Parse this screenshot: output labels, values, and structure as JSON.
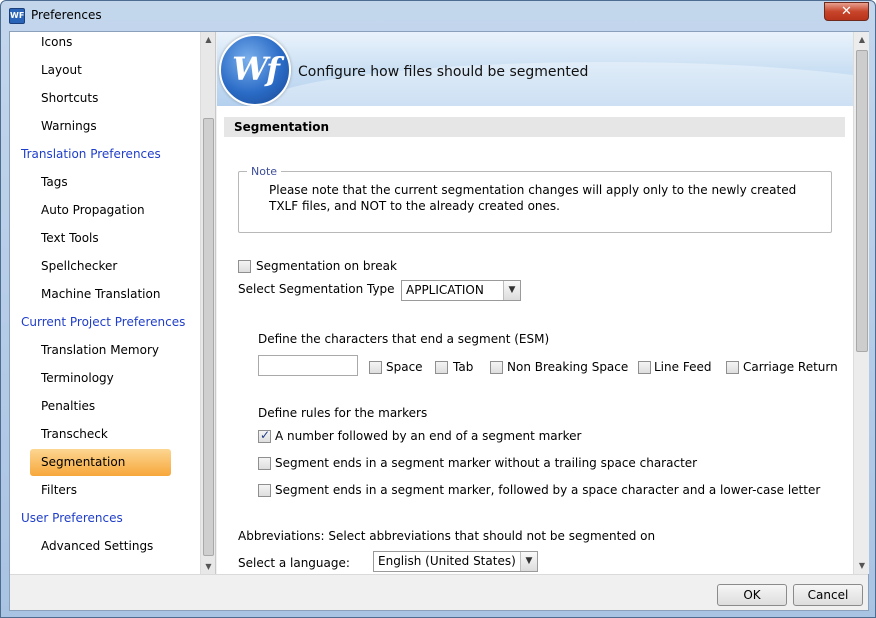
{
  "window": {
    "title": "Preferences",
    "icon_text": "WF"
  },
  "sidebar": {
    "items": [
      {
        "label": "Icons",
        "level": "child"
      },
      {
        "label": "Layout",
        "level": "child"
      },
      {
        "label": "Shortcuts",
        "level": "child"
      },
      {
        "label": "Warnings",
        "level": "child"
      },
      {
        "label": "Translation Preferences",
        "level": "header"
      },
      {
        "label": "Tags",
        "level": "child"
      },
      {
        "label": "Auto Propagation",
        "level": "child"
      },
      {
        "label": "Text Tools",
        "level": "child"
      },
      {
        "label": "Spellchecker",
        "level": "child"
      },
      {
        "label": "Machine Translation",
        "level": "child"
      },
      {
        "label": "Current Project Preferences",
        "level": "header"
      },
      {
        "label": "Translation Memory",
        "level": "child"
      },
      {
        "label": "Terminology",
        "level": "child"
      },
      {
        "label": "Penalties",
        "level": "child"
      },
      {
        "label": "Transcheck",
        "level": "child"
      },
      {
        "label": "Segmentation",
        "level": "child",
        "selected": true
      },
      {
        "label": "Filters",
        "level": "child"
      },
      {
        "label": "User Preferences",
        "level": "header"
      },
      {
        "label": "Advanced Settings",
        "level": "child"
      }
    ]
  },
  "banner": {
    "logo_text": "Wf",
    "title": "Configure how files should be segmented"
  },
  "section": {
    "title": "Segmentation"
  },
  "note": {
    "legend": "Note",
    "text": "Please note that the current segmentation changes will apply only to the newly created TXLF files, and NOT to the already created ones."
  },
  "segmentation_on_break": {
    "label": "Segmentation on break",
    "checked": false
  },
  "segmentation_type": {
    "label": "Select Segmentation Type",
    "value": "APPLICATION"
  },
  "esm": {
    "label": "Define the characters that end a segment (ESM)",
    "value": "",
    "options": [
      {
        "label": "Space",
        "checked": false
      },
      {
        "label": "Tab",
        "checked": false
      },
      {
        "label": "Non Breaking Space",
        "checked": false
      },
      {
        "label": "Line Feed",
        "checked": false
      },
      {
        "label": "Carriage Return",
        "checked": false
      }
    ]
  },
  "marker_rules": {
    "label": "Define rules for the markers",
    "rules": [
      {
        "label": "A number followed by an end of a segment marker",
        "checked": true
      },
      {
        "label": "Segment ends in a segment marker without a trailing space character",
        "checked": false
      },
      {
        "label": "Segment ends in a segment marker, followed by a space character and a lower-case letter",
        "checked": false
      }
    ]
  },
  "abbreviations": {
    "label": "Abbreviations: Select abbreviations that should not be segmented on",
    "language_label": "Select a language:",
    "language_value": "English (United States)"
  },
  "footer": {
    "ok_label": "OK",
    "cancel_label": "Cancel"
  },
  "close_glyph": "✕",
  "colors": {
    "selection": "#f7a73a",
    "header_link": "#1f3ec9"
  }
}
